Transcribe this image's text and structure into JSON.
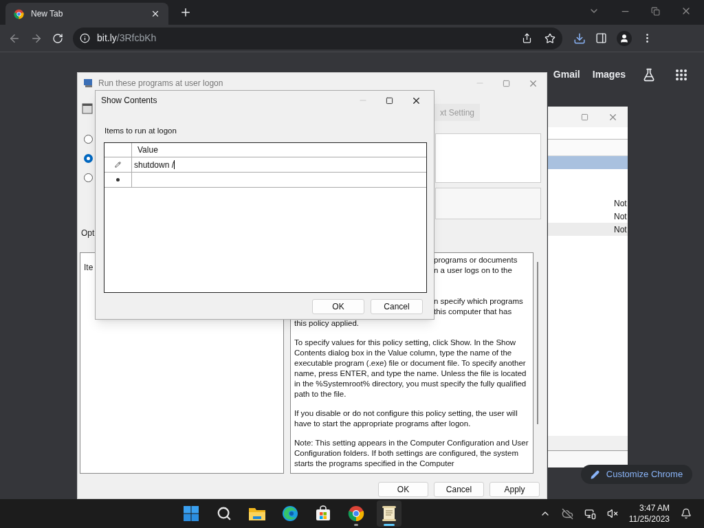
{
  "browser": {
    "tabs": [
      {
        "title": "New Tab",
        "selected": true
      }
    ],
    "url": {
      "host": "bit.ly",
      "path": "/3RfcbKh"
    },
    "links": [
      "Gmail",
      "Images"
    ],
    "customize_button": "Customize Chrome"
  },
  "background_window": {
    "rows": [
      {
        "selected": true
      },
      {
        "selected": false,
        "state": "Not"
      },
      {
        "selected": false,
        "state": "Not"
      },
      {
        "selected": false,
        "state": "Not"
      }
    ]
  },
  "policy_dialog": {
    "title": "Run these programs at user logon",
    "next_button": "xt Setting",
    "radios": [
      {
        "selected": false
      },
      {
        "selected": true
      },
      {
        "selected": false
      }
    ],
    "options_label": "Opt",
    "options_text": "Ite",
    "help_fragments": [
      "programs or documents",
      "n a user logs on to the",
      "n specify which programs",
      "this computer that has",
      "this policy applied."
    ],
    "help_paragraphs": [
      "To specify values for this policy setting, click Show. In the Show Contents dialog box in the Value column, type the name of the executable program (.exe) file or document file. To specify another name, press ENTER, and type the name. Unless the file is located in the %Systemroot% directory, you must specify the fully qualified path to the file.",
      "If you disable or do not configure this policy setting, the user will have to start the appropriate programs after logon.",
      "Note: This setting appears in the Computer Configuration and User Configuration folders. If both settings are configured, the system starts the programs specified in the Computer"
    ],
    "buttons": [
      "OK",
      "Cancel",
      "Apply"
    ]
  },
  "show_contents": {
    "title": "Show Contents",
    "label": "Items to run at logon",
    "column": "Value",
    "rows": [
      {
        "kind": "edit",
        "value": "shutdown /"
      },
      {
        "kind": "new"
      }
    ],
    "buttons": [
      "OK",
      "Cancel"
    ]
  },
  "taskbar": {
    "apps": [
      {
        "kind": "start",
        "open": false,
        "selected": false
      },
      {
        "kind": "search",
        "open": false,
        "selected": false
      },
      {
        "kind": "folder",
        "open": false,
        "selected": false
      },
      {
        "kind": "edge",
        "open": false,
        "selected": false
      },
      {
        "kind": "store",
        "open": false,
        "selected": false
      },
      {
        "kind": "chrome",
        "open": true,
        "selected": false
      },
      {
        "kind": "notepad",
        "open": true,
        "selected": true
      }
    ],
    "time": "3:47 AM",
    "date": "11/25/2023"
  }
}
